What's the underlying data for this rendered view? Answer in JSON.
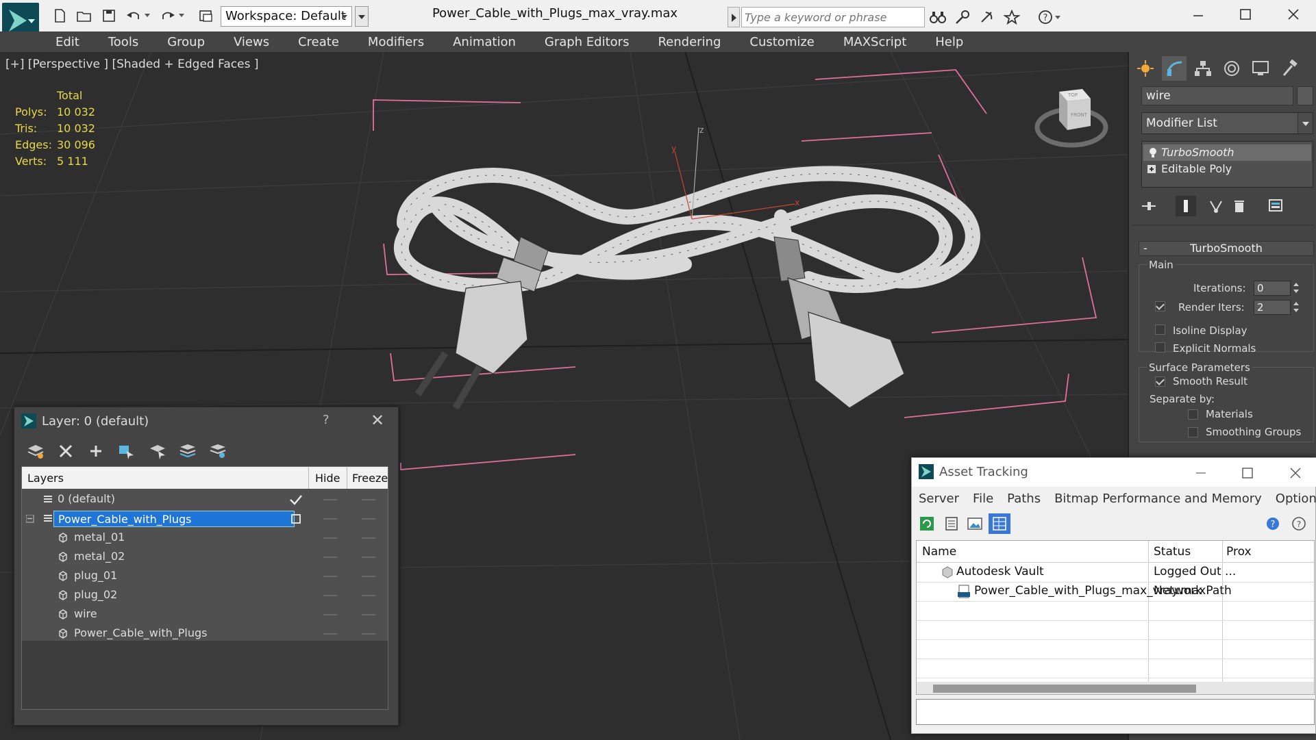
{
  "titlebar": {
    "workspace_label": "Workspace: Default",
    "document_title": "Power_Cable_with_Plugs_max_vray.max",
    "search_placeholder": "Type a keyword or phrase"
  },
  "menubar": {
    "items": [
      "Edit",
      "Tools",
      "Group",
      "Views",
      "Create",
      "Modifiers",
      "Animation",
      "Graph Editors",
      "Rendering",
      "Customize",
      "MAXScript",
      "Help"
    ]
  },
  "viewport": {
    "label": "[+] [Perspective ] [Shaded + Edged Faces ]",
    "stats": {
      "total_label": "Total",
      "rows": [
        {
          "label": "Polys:",
          "value": "10 032"
        },
        {
          "label": "Tris:",
          "value": "10 032"
        },
        {
          "label": "Edges:",
          "value": "30 096"
        },
        {
          "label": "Verts:",
          "value": "5 111"
        }
      ]
    },
    "gizmo": {
      "x": "x",
      "y": "y",
      "z": "z"
    },
    "viewcube": {
      "top": "TOP",
      "front": "FRONT"
    }
  },
  "command_panel": {
    "object_name": "wire",
    "modifier_list_label": "Modifier List",
    "stack": [
      "TurboSmooth",
      "Editable Poly"
    ],
    "rollout_title": "TurboSmooth",
    "main_group": "Main",
    "iterations_label": "Iterations:",
    "iterations_value": "0",
    "render_iters_label": "Render Iters:",
    "render_iters_value": "2",
    "render_iters_checked": true,
    "isoline_label": "Isoline Display",
    "isoline_checked": false,
    "explicit_normals_label": "Explicit Normals",
    "explicit_normals_checked": false,
    "surface_group": "Surface Parameters",
    "smooth_result_label": "Smooth Result",
    "smooth_result_checked": true,
    "separate_by_label": "Separate by:",
    "materials_label": "Materials",
    "materials_checked": false,
    "smoothing_groups_label": "Smoothing Groups",
    "smoothing_groups_checked": false
  },
  "layer_dialog": {
    "title": "Layer: 0 (default)",
    "help": "?",
    "columns": {
      "layers": "Layers",
      "hide": "Hide",
      "freeze": "Freeze"
    },
    "rows": [
      {
        "name": "0 (default)",
        "level": 0,
        "active": true
      },
      {
        "name": "Power_Cable_with_Plugs",
        "level": 0,
        "selected": true
      },
      {
        "name": "metal_01",
        "level": 1
      },
      {
        "name": "metal_02",
        "level": 1
      },
      {
        "name": "plug_01",
        "level": 1
      },
      {
        "name": "plug_02",
        "level": 1
      },
      {
        "name": "wire",
        "level": 1
      },
      {
        "name": "Power_Cable_with_Plugs",
        "level": 1
      }
    ]
  },
  "asset_tracking": {
    "title": "Asset Tracking",
    "menu": [
      "Server",
      "File",
      "Paths",
      "Bitmap Performance and Memory",
      "Options"
    ],
    "columns": {
      "name": "Name",
      "status": "Status",
      "proxy": "Prox"
    },
    "rows": [
      {
        "name": "Autodesk Vault",
        "status": "Logged Out ..."
      },
      {
        "name": "Power_Cable_with_Plugs_max_vray.max",
        "status": "Network Path"
      }
    ]
  },
  "colors": {
    "accent_selected": "#1f75d6",
    "stats_yellow": "#e8d84a",
    "bbox_pink": "#e0709a",
    "ui_dark": "#444444"
  }
}
